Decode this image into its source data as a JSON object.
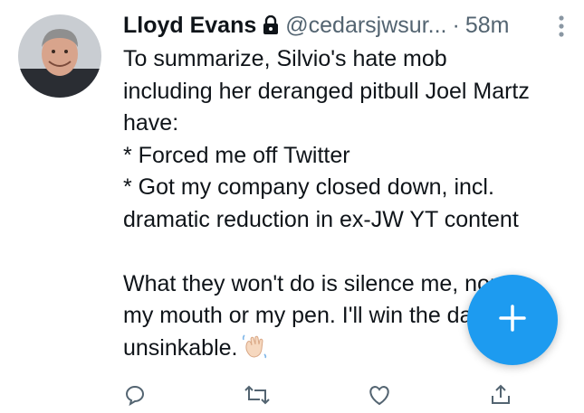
{
  "tweet": {
    "author_name": "Lloyd Evans",
    "handle": "@cedarsjwsur...",
    "separator": "·",
    "time": "58m",
    "body": "To summarize, Silvio's hate mob\nincluding her deranged pitbull Joel Martz\nhave:\n* Forced me off Twitter\n* Got my company closed down, incl.\ndramatic reduction in ex-JW YT content\n\nWhat they won't do is silence me, nor\nmy mouth or my pen. I'll win the day. I'm\nunsinkable.",
    "icons": {
      "lock": "lock-icon",
      "more": "more-vertical-icon",
      "emoji": "waving-hand-icon",
      "reply": "reply-icon",
      "retweet": "retweet-icon",
      "like": "heart-icon",
      "share": "share-icon"
    }
  },
  "fab": {
    "icon": "plus-icon"
  },
  "colors": {
    "accent": "#1d9bf0",
    "text": "#0f1419",
    "secondary": "#536471"
  }
}
